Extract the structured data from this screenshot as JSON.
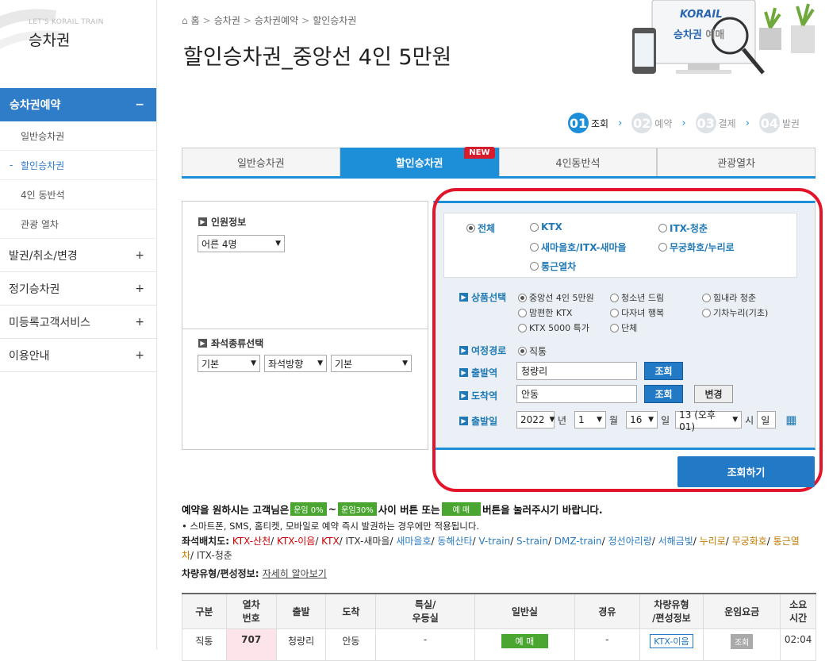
{
  "sidebar": {
    "sub": "LET'S KORAIL TRAIN",
    "title": "승차권",
    "active_section": {
      "label": "승차권예약",
      "toggle": "−"
    },
    "sub_items": [
      {
        "label": "일반승차권"
      },
      {
        "label": "할인승차권",
        "prefix": "-"
      },
      {
        "label": "4인 동반석"
      },
      {
        "label": "관광 열차"
      }
    ],
    "menus": [
      {
        "label": "발권/취소/변경",
        "toggle": "+"
      },
      {
        "label": "정기승차권",
        "toggle": "+"
      },
      {
        "label": "미등록고객서비스",
        "toggle": "+"
      },
      {
        "label": "이용안내",
        "toggle": "+"
      }
    ]
  },
  "breadcrumb": [
    "홈",
    "승차권",
    "승차권예약",
    "할인승차권"
  ],
  "page_title": "할인승차권_중앙선 4인 5만원",
  "illustration": {
    "brand": "KORAIL",
    "caption_a": "승차권",
    "caption_b": "예매"
  },
  "steps": [
    {
      "num": "01",
      "label": "조회"
    },
    {
      "num": "02",
      "label": "예약"
    },
    {
      "num": "03",
      "label": "결제"
    },
    {
      "num": "04",
      "label": "발권"
    }
  ],
  "tabs": [
    {
      "label": "일반승차권"
    },
    {
      "label": "할인승차권",
      "badge": "NEW"
    },
    {
      "label": "4인동반석"
    },
    {
      "label": "관광열차"
    }
  ],
  "left": {
    "passenger_label": "인원정보",
    "passenger_value": "어른 4명",
    "seat_label": "좌석종류선택",
    "seat_selects": [
      "기본",
      "좌석방향",
      "기본"
    ]
  },
  "train_types": [
    "전체",
    "KTX",
    "ITX-청춘",
    "새마을호/ITX-새마을",
    "무궁화호/누리로",
    "통근열차"
  ],
  "product_label": "상품선택",
  "products": [
    "중앙선 4인 5만원",
    "청소년 드림",
    "힘내라 청춘",
    "맘편한 KTX",
    "다자녀 행복",
    "기차누리(기초)",
    "KTX 5000 특가",
    "단체"
  ],
  "route_label": "여정경로",
  "route_value": "직통",
  "dep_label": "출발역",
  "dep_value": "청량리",
  "arr_label": "도착역",
  "arr_value": "안동",
  "search_btn": "조회",
  "change_btn": "변경",
  "date_label": "출발일",
  "date": {
    "year": "2022",
    "year_unit": "년",
    "month": "1",
    "month_unit": "월",
    "day": "16",
    "day_unit": "일",
    "hour": "13 (오후01)",
    "hour_unit": "시",
    "min_unit": "일"
  },
  "main_search_btn": "조회하기",
  "notice": {
    "l1_a": "예약을 원하시는 고객님은",
    "tag1": "운임 0%",
    "tilde": "~",
    "tag2": "운임30%",
    "l1_b": "사이 버튼 또는",
    "tag3": "예 매",
    "l1_c": "버튼을 눌러주시기 바랍니다.",
    "l2": "• 스마트폰, SMS, 홈티켓, 모바일로 예약 즉시 발권하는 경우에만 적용됩니다."
  },
  "seat_layout": {
    "label": "좌석배치도:",
    "items": [
      {
        "t": "KTX-산천",
        "c": "#c00"
      },
      {
        "t": "KTX-이음",
        "c": "#c00"
      },
      {
        "t": "KTX",
        "c": "#c00"
      },
      {
        "t": "ITX-새마을",
        "c": "#333"
      },
      {
        "t": "새마을호",
        "c": "#2a7bc0"
      },
      {
        "t": "동해산타",
        "c": "#2a7bc0"
      },
      {
        "t": "V-train",
        "c": "#2a7bc0"
      },
      {
        "t": "S-train",
        "c": "#2a7bc0"
      },
      {
        "t": "DMZ-train",
        "c": "#2a7bc0"
      },
      {
        "t": "정선아리랑",
        "c": "#2a7bc0"
      },
      {
        "t": "서해금빛",
        "c": "#2a7bc0"
      },
      {
        "t": "누리로",
        "c": "#c07a00"
      },
      {
        "t": "무궁화호",
        "c": "#c07a00"
      },
      {
        "t": "통근열차",
        "c": "#c07a00"
      },
      {
        "t": "ITX-청춘",
        "c": "#333"
      }
    ]
  },
  "vehicle": {
    "label": "차량유형/편성정보:",
    "link": "자세히 알아보기"
  },
  "table": {
    "headers": [
      "구분",
      "열차\n번호",
      "출발",
      "도착",
      "특실/\n우등실",
      "일반실",
      "경유",
      "차량유형\n/편성정보",
      "운임요금",
      "소요\n시간"
    ],
    "row": [
      "직통",
      "707",
      "청량리",
      "안동",
      "-",
      "예 매",
      "-",
      "KTX-이음",
      "조회",
      "02:04"
    ]
  },
  "colors": {
    "accent": "#1d8ed8",
    "sidebar_active": "#2f7cc9",
    "highlight": "#e3152b",
    "green": "#4aa630"
  }
}
